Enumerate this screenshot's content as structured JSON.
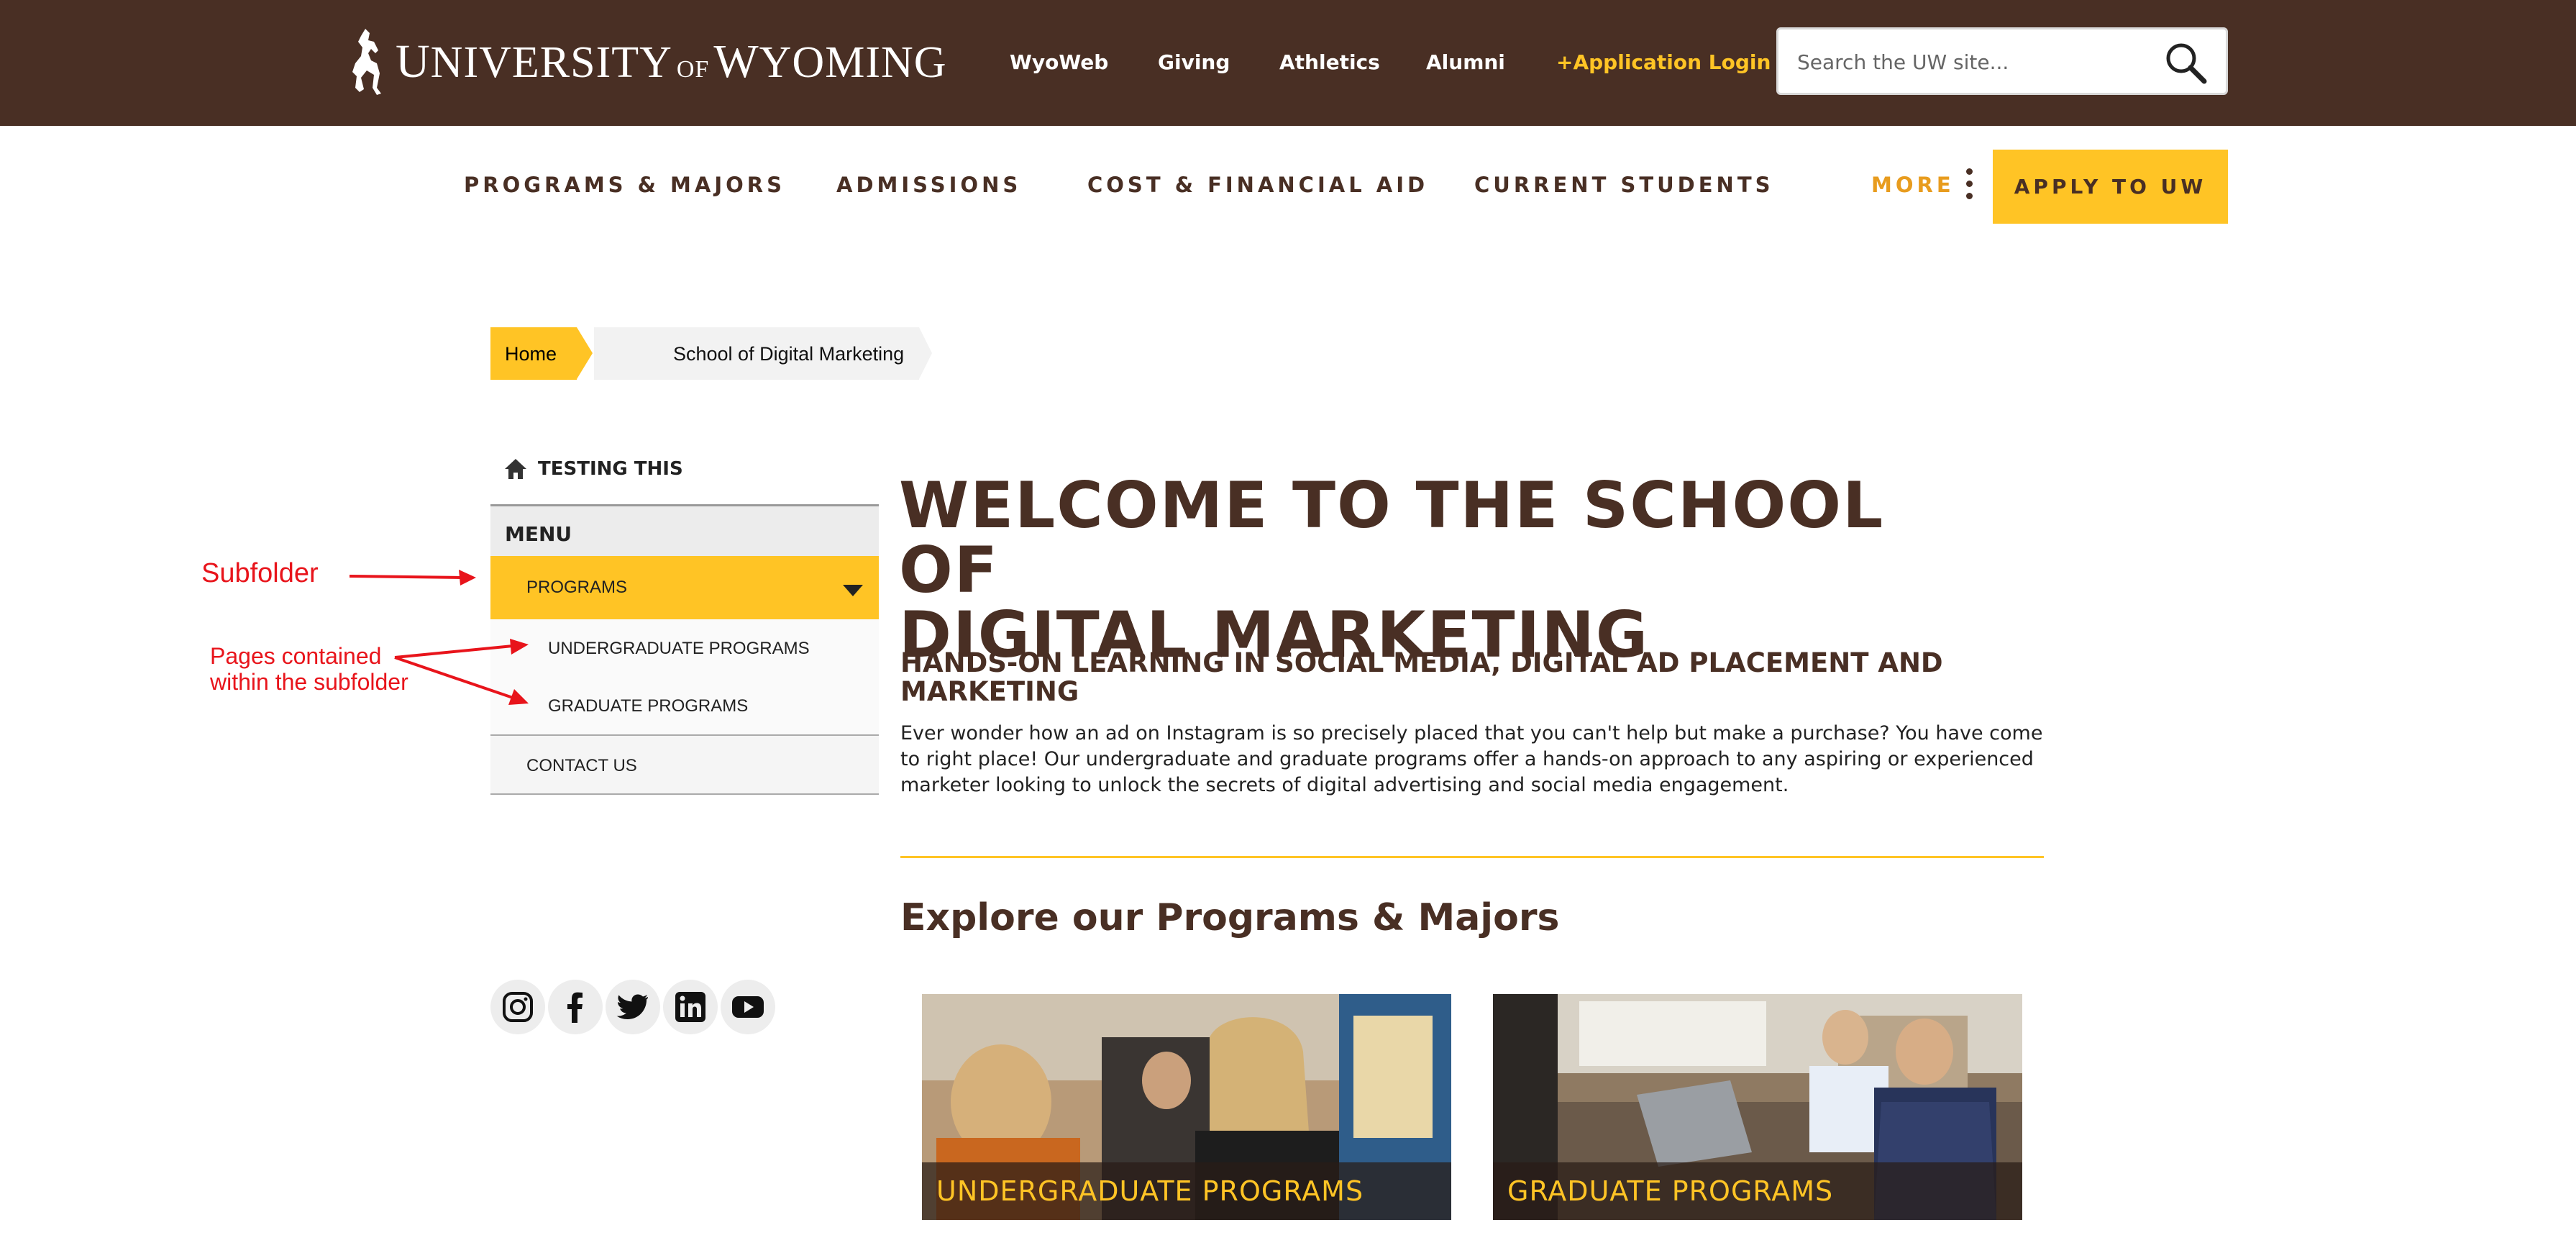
{
  "header": {
    "logo": "UNIVERSITY of WYOMING",
    "utility_links": [
      "WyoWeb",
      "Giving",
      "Athletics",
      "Alumni",
      "+Application Login"
    ],
    "search_placeholder": "Search the UW site..."
  },
  "nav": {
    "items": [
      "PROGRAMS & MAJORS",
      "ADMISSIONS",
      "COST & FINANCIAL AID",
      "CURRENT STUDENTS"
    ],
    "more": "MORE",
    "apply": "APPLY TO UW"
  },
  "breadcrumb": {
    "home": "Home",
    "current": "School of Digital Marketing"
  },
  "sidebar": {
    "home_label": "TESTING THIS",
    "menu_label": "MENU",
    "folder": "PROGRAMS",
    "sub_items": [
      "UNDERGRADUATE PROGRAMS",
      "GRADUATE PROGRAMS"
    ],
    "contact": "CONTACT US"
  },
  "social": [
    "instagram-icon",
    "facebook-icon",
    "twitter-icon",
    "linkedin-icon",
    "youtube-icon"
  ],
  "annotations": {
    "subfolder": "Subfolder",
    "pages_line1": "Pages contained",
    "pages_line2": "within the subfolder"
  },
  "main": {
    "title_line1": "WELCOME TO THE SCHOOL OF",
    "title_line2": "DIGITAL MARKETING",
    "subhead": "HANDS-ON LEARNING IN SOCIAL MEDIA, DIGITAL AD PLACEMENT AND MARKETING",
    "intro": "Ever wonder how an ad on Instagram is so precisely placed that you can't help but make a purchase? You have come to right place! Our undergraduate and graduate programs offer a hands-on approach to any aspiring or experienced marketer looking to unlock the secrets of digital advertising and social media engagement.",
    "section_title": "Explore our Programs & Majors",
    "cards": [
      "UNDERGRADUATE PROGRAMS",
      "GRADUATE PROGRAMS"
    ]
  },
  "colors": {
    "brown": "#492f24",
    "gold": "#ffc425",
    "orange": "#e89c1e",
    "annotation_red": "#e8141b"
  }
}
